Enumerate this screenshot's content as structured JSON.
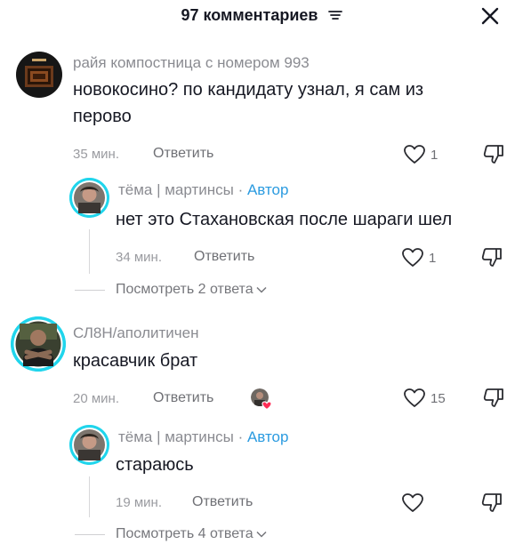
{
  "header": {
    "title": "97 комментариев",
    "filter_icon": "filter-icon",
    "close_icon": "close-icon"
  },
  "accent": "#20d5ec",
  "author_color": "#2b9be0",
  "comments": [
    {
      "username": "райя компостница с номером 993",
      "text_line1": "новокосино? по кандидату узнал, я сам из",
      "text_line2": "перово",
      "time": "35 мин.",
      "reply": "Ответить",
      "likes": "1",
      "replies": [
        {
          "username": "тёма | мартинсы",
          "author_label": "Автор",
          "separator": " · ",
          "text": "нет это Стахановская после шараги шел",
          "time": "34 мин.",
          "reply": "Ответить",
          "likes": "1"
        }
      ],
      "view_more": "Посмотреть 2 ответа"
    },
    {
      "username": "СЛ8Н/аполитичен",
      "text": "красавчик брат",
      "time": "20 мин.",
      "reply": "Ответить",
      "likes": "15",
      "replies": [
        {
          "username": "тёма | мартинсы",
          "author_label": "Автор",
          "separator": " · ",
          "text": "стараюсь",
          "time": "19 мин.",
          "reply": "Ответить",
          "likes": ""
        }
      ],
      "view_more": "Посмотреть 4 ответа"
    }
  ]
}
